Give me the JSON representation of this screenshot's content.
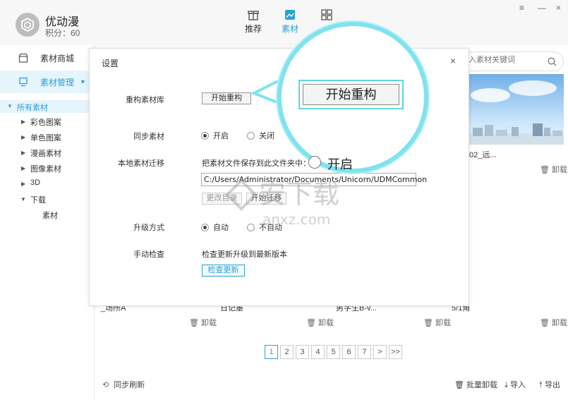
{
  "header": {
    "app_name": "优动漫",
    "points": "积分：60",
    "tabs": [
      {
        "label": "推荐",
        "icon": "gift-icon"
      },
      {
        "label": "素材",
        "icon": "image-icon",
        "active": true
      },
      {
        "label": "",
        "icon": "grid-icon"
      }
    ],
    "window_controls": [
      "≡",
      "—",
      "×"
    ]
  },
  "sidebar": {
    "store_label": "素材商城",
    "manage_label": "素材管理",
    "tree": {
      "all": "所有素材",
      "items": [
        "彩色图案",
        "单色图案",
        "漫画素材",
        "图像素材",
        "3D",
        "下载"
      ],
      "sub_item": "素材"
    }
  },
  "content": {
    "search_placeholder": "入素材关键词",
    "thumb_caption": "02_远...",
    "uninstall": "卸载",
    "row_texts": [
      "_场所A",
      "日记墨",
      "男学生B-v...",
      "5/1角"
    ],
    "pagination": [
      "1",
      "2",
      "3",
      "4",
      "5",
      "6",
      "7",
      ">",
      ">>"
    ],
    "sync_refresh": "同步刷新",
    "batch_uninstall": "批量卸载",
    "import": "导入",
    "export": "导出"
  },
  "settings": {
    "title": "设置",
    "close": "×",
    "rebuild_label": "重构素材库",
    "rebuild_button": "开始重构",
    "sync_label": "同步素材",
    "sync_on": "开启",
    "sync_off": "关闭",
    "migrate_label": "本地素材迁移",
    "migrate_desc": "把素材文件保存到此文件夹中：",
    "migrate_path": "C:/Users/Administrator/Documents/Unicorn/UDMCommon",
    "change_dir": "更改目录",
    "start_migrate": "开始迁移",
    "upgrade_label": "升级方式",
    "upgrade_auto": "自动",
    "upgrade_manual": "不自动",
    "check_label": "手动检查",
    "check_desc": "检查更新升级到最新版本",
    "check_button": "检查更新"
  },
  "callout": {
    "button": "开始重构",
    "radio": "开启"
  },
  "watermark": {
    "text": "安下载",
    "sub": "anxz.com"
  },
  "colors": {
    "accent": "#2aa2d6",
    "callout_ring": "#7fe3ef"
  }
}
